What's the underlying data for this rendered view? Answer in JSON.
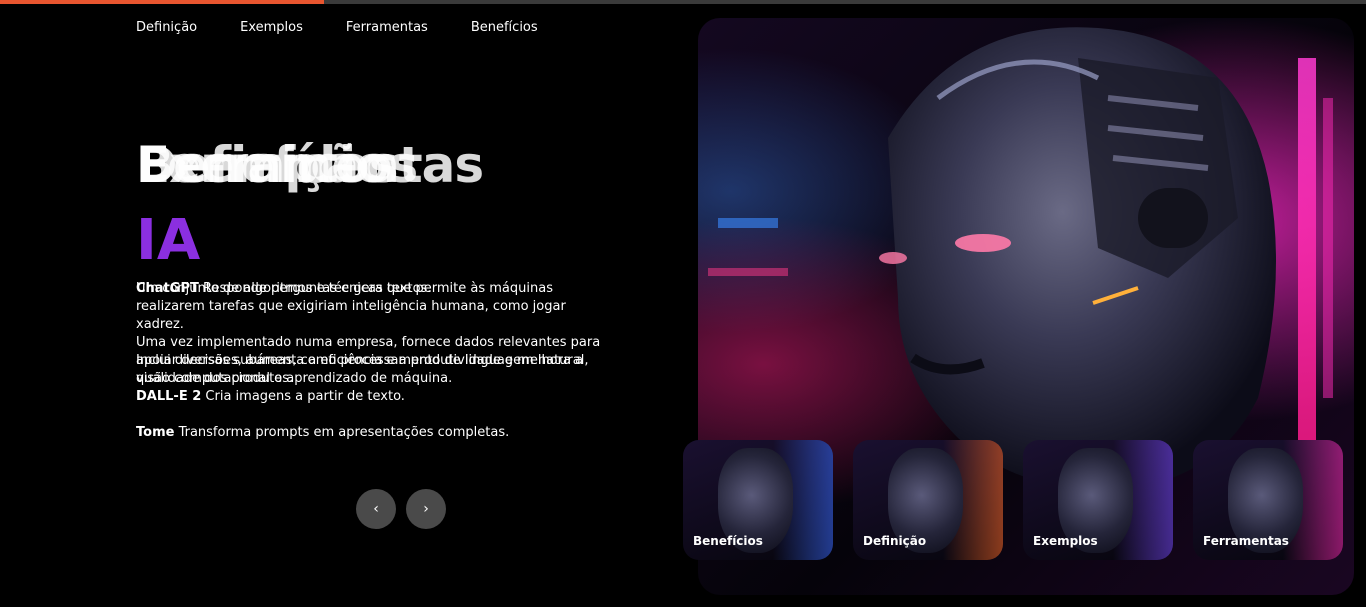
{
  "progress": 0.237,
  "accent_color": "#e8552f",
  "ia_color": "#8b2fe0",
  "nav": {
    "items": [
      "Definição",
      "Exemplos",
      "Ferramentas",
      "Benefícios"
    ]
  },
  "hero": {
    "titles": [
      "Definição",
      "Exemplos",
      "Ferramentas",
      "Benefícios"
    ],
    "ia": "IA",
    "paragraphs": [
      {
        "bold": "ChatGPT",
        "text": " Responde perguntas e gera textos."
      },
      {
        "bold": "",
        "text": "Um conjunto de algoritmos e técnicas que permite às máquinas realizarem tarefas que exigiriam inteligência humana, como jogar xadrez."
      },
      {
        "bold": "",
        "text": "Uma vez implementado numa empresa, fornece dados relevantes para apoiar decisões, aumenta a eficiência e a produtividade e melhora a qualidade dos produtos."
      },
      {
        "bold": "",
        "text": "Inclui diversas subáreas, como processamento de linguagem natural, visão computacional e aprendizado de máquina."
      },
      {
        "bold": "DALL-E 2",
        "text": " Cria imagens a partir de texto."
      },
      {
        "bold": "Tome",
        "text": " Transforma prompts em apresentações completas."
      }
    ]
  },
  "controls": {
    "prev": "‹",
    "next": "›"
  },
  "thumbnails": [
    {
      "label": "Benefícios",
      "glow": "#3a6aff"
    },
    {
      "label": "Definição",
      "glow": "#ff6a2a"
    },
    {
      "label": "Exemplos",
      "glow": "#7a4aff"
    },
    {
      "label": "Ferramentas",
      "glow": "#ff2ab8"
    }
  ]
}
